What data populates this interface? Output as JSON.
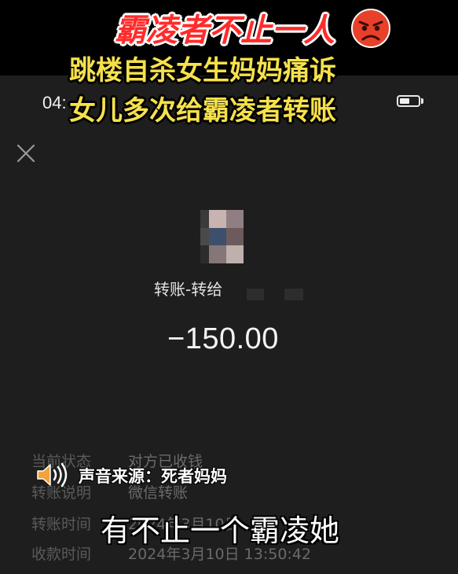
{
  "video_caption": {
    "headline": "霸凌者不止一人",
    "headline_icon": "angry-face-emoji",
    "line1": "跳楼自杀女生妈妈痛诉",
    "line2": "女儿多次给霸凌者转账",
    "headline_color": "#ff2b2b",
    "line_color": "#f6e14b"
  },
  "status_bar": {
    "time": "04:",
    "battery_level": 0.55
  },
  "transfer_detail": {
    "close_icon": "close-icon",
    "title": "转账-转给",
    "amount": "−150.00",
    "rows": [
      {
        "label": "当前状态",
        "value": "对方已收钱"
      },
      {
        "label": "转账说明",
        "value": "微信转账"
      },
      {
        "label": "转账时间",
        "value": "2024年3月10日"
      },
      {
        "label": "收款时间",
        "value": "2024年3月10日 13:50:42"
      }
    ]
  },
  "overlay": {
    "speaker_icon": "speaker-icon",
    "sound_source": "声音来源：死者妈妈",
    "subtitle": "有不止一个霸凌她"
  }
}
